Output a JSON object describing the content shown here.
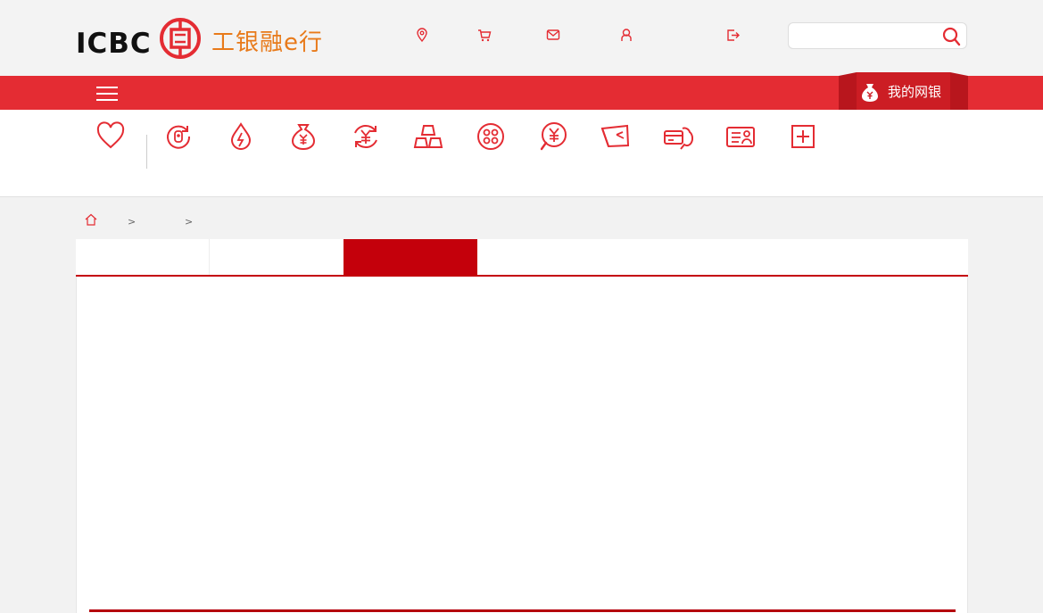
{
  "header": {
    "logo_text": "ICBC",
    "logo_cn": "工银融e行",
    "search": {
      "placeholder": "",
      "value": ""
    }
  },
  "top_icons": [
    "location-pin-icon",
    "cart-icon",
    "mail-icon",
    "user-icon",
    "logout-icon"
  ],
  "nav": {
    "my_bank_label": "我的网银"
  },
  "quick_icons": [
    "favorites-heart-icon",
    "deposit-icon",
    "utilities-icon",
    "money-bag-icon",
    "exchange-icon",
    "gold-bars-icon",
    "investment-dots-icon",
    "yuan-search-icon",
    "ticket-icon",
    "credit-card-icon",
    "id-card-icon",
    "add-more-icon"
  ],
  "breadcrumb": {
    "sep1": ">",
    "sep2": ">"
  },
  "tabs": [
    {
      "label": ""
    },
    {
      "label": ""
    },
    {
      "label": "",
      "active": true
    }
  ],
  "colors": {
    "brand_red": "#e42c33",
    "tab_active_red": "#c4000b",
    "logo_orange": "#e87a1a"
  }
}
